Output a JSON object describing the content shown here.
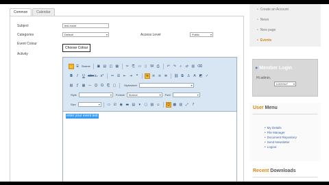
{
  "tabs": [
    {
      "label": "Common"
    },
    {
      "label": "Calendar"
    }
  ],
  "form": {
    "subject_label": "Subject",
    "subject_value": "test event",
    "categories_label": "Categories",
    "categories_value": "Default",
    "access_level_label": "Access Level",
    "access_level_value": "Public",
    "event_colour_label": "Event Colour",
    "choose_colour_label": "Choose Colour",
    "activity_label": "Activity"
  },
  "editor": {
    "source_label": "Source",
    "stylesheet_label": "Stylesheet",
    "style_label": "Style",
    "format_label": "Format",
    "format_value": "Normal",
    "font_label": "Font",
    "size_label": "Size",
    "content_text": "enter your event text"
  },
  "sidebar": {
    "nav": [
      {
        "label": "Create an Account"
      },
      {
        "label": "News"
      },
      {
        "label": "New page"
      },
      {
        "label": "Events"
      }
    ],
    "login": {
      "title": "Member Login",
      "user_text": "Hi admin,",
      "select_value": "LOGOUT"
    },
    "user_menu": {
      "title_accent": "User",
      "title_rest": " Menu",
      "links": [
        {
          "label": "My Details"
        },
        {
          "label": "File Manager"
        },
        {
          "label": "Document Repository"
        },
        {
          "label": "Send Newsletter"
        },
        {
          "label": "Logout"
        }
      ]
    },
    "downloads": {
      "title_accent": "Recent",
      "title_rest": " Downloads"
    }
  }
}
